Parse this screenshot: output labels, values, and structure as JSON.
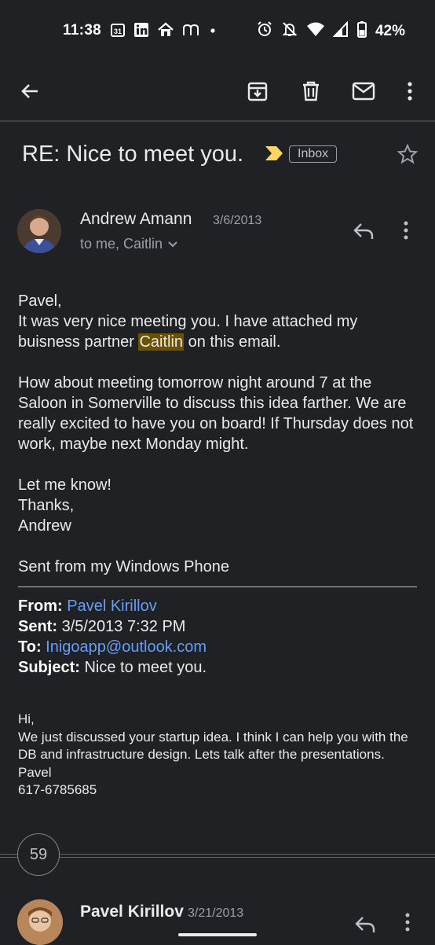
{
  "status_bar": {
    "time": "11:38",
    "calendar_day": "31",
    "battery": "42%",
    "left_icons": [
      "calendar-icon",
      "linkedin-icon",
      "home-icon",
      "m-icon",
      "dot-icon"
    ],
    "right_icons": [
      "alarm-icon",
      "bell-off-icon",
      "wifi-icon",
      "signal-icon",
      "battery-icon"
    ]
  },
  "toolbar": {
    "icons": [
      "back-arrow-icon",
      "archive-icon",
      "delete-icon",
      "mark-unread-icon",
      "more-vert-icon"
    ]
  },
  "email": {
    "subject": "RE: Nice to meet you.",
    "label": "Inbox",
    "important_color": "#fdd663",
    "sender": {
      "name": "Andrew Amann",
      "date": "3/6/2013",
      "recipients": "to me, Caitlin"
    },
    "body": {
      "l1": "Pavel,",
      "l2": "It was very nice meeting you. I have attached my buisness partner",
      "highlight": "Caitlin",
      "l2_end": " on this email.",
      "p2": "How about meeting tomorrow night around 7 at the Saloon in Somerville to discuss this idea farther. We are really excited to have you on board! If Thursday does not work, maybe next Monday might.",
      "p3_1": "Let me know!",
      "p3_2": "Thanks,",
      "p3_3": "Andrew",
      "signature": "Sent from my Windows Phone"
    },
    "quoted_header": {
      "from_label": "From:",
      "from_value": "Pavel Kirillov",
      "sent_label": "Sent:",
      "sent_value": "3/5/2013 7:32 PM",
      "to_label": "To:",
      "to_value": "Inigoapp@outlook.com",
      "subject_label": "Subject:",
      "subject_value": "Nice to meet you."
    },
    "quoted_body": {
      "l1": "Hi,",
      "l2": "We just discussed your startup idea. I think I can help you with the DB and infrastructure design. Lets talk after the presentations.",
      "l3": "Pavel",
      "l4": "617-6785685"
    }
  },
  "thread": {
    "collapsed_count": "59",
    "next_sender": "Pavel Kirillov",
    "next_date": "3/21/2013"
  },
  "colors": {
    "background": "#202124",
    "link": "#669df6",
    "highlight": "#6a5200"
  }
}
